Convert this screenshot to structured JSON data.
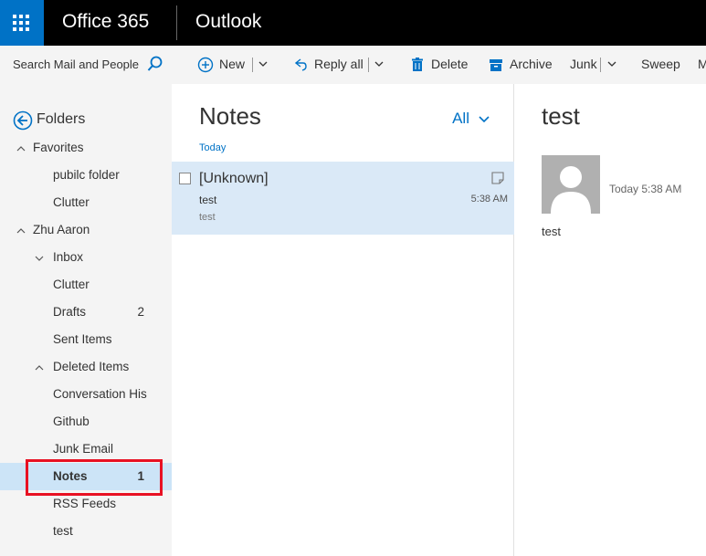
{
  "header": {
    "brand": "Office 365",
    "app": "Outlook"
  },
  "search": {
    "placeholder": "Search Mail and People"
  },
  "toolbar": {
    "new_label": "New",
    "reply_all_label": "Reply all",
    "delete_label": "Delete",
    "archive_label": "Archive",
    "junk_label": "Junk",
    "sweep_label": "Sweep",
    "more_label": "M"
  },
  "nav": {
    "folders_label": "Folders",
    "items": [
      {
        "label": "Favorites",
        "count": ""
      },
      {
        "label": "pubilc folder",
        "count": ""
      },
      {
        "label": "Clutter",
        "count": ""
      },
      {
        "label": "Zhu Aaron",
        "count": ""
      },
      {
        "label": "Inbox",
        "count": ""
      },
      {
        "label": "Clutter",
        "count": ""
      },
      {
        "label": "Drafts",
        "count": "2"
      },
      {
        "label": "Sent Items",
        "count": ""
      },
      {
        "label": "Deleted Items",
        "count": ""
      },
      {
        "label": "Conversation His",
        "count": ""
      },
      {
        "label": "Github",
        "count": ""
      },
      {
        "label": "Junk Email",
        "count": ""
      },
      {
        "label": "Notes",
        "count": "1"
      },
      {
        "label": "RSS Feeds",
        "count": ""
      },
      {
        "label": "test",
        "count": ""
      }
    ]
  },
  "list": {
    "title": "Notes",
    "filter": "All",
    "group": "Today",
    "messages": [
      {
        "sender": "[Unknown]",
        "subject": "test",
        "time": "5:38 AM",
        "preview": "test"
      }
    ]
  },
  "reading": {
    "subject": "test",
    "time": "Today 5:38 AM",
    "body": "test"
  },
  "colors": {
    "accent": "#0072c6",
    "topbar": "#000000",
    "selection": "#cce4f7",
    "highlight": "#e81123"
  }
}
